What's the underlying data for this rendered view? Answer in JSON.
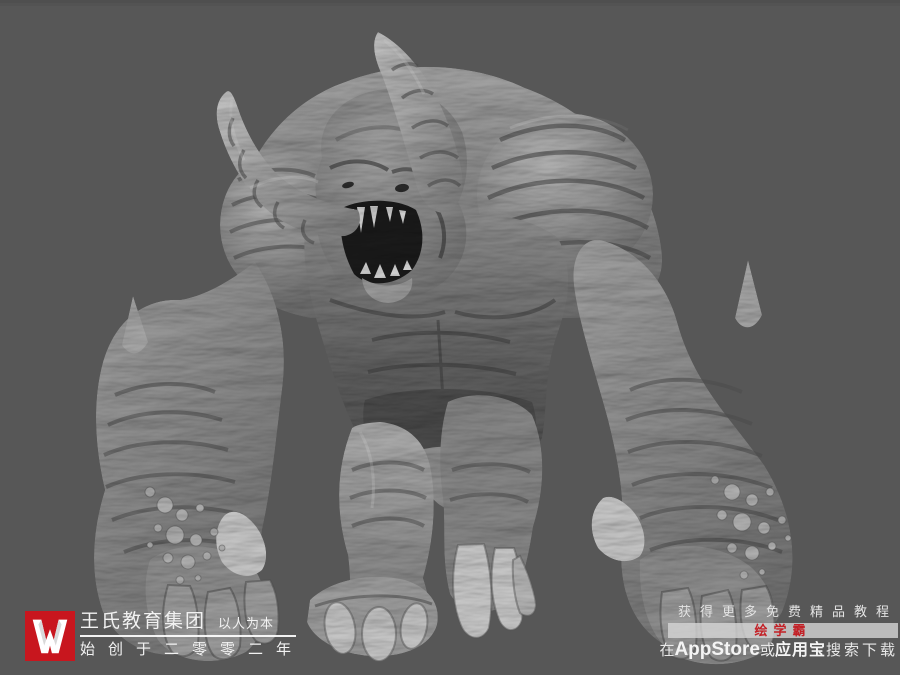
{
  "colors": {
    "background": "#575757",
    "brand_red": "#c8161e",
    "badge_text_red": "#c32026",
    "badge_bar_bg": "rgba(214,214,214,0.8)",
    "watermark_text": "#f2f2f2"
  },
  "artwork": {
    "alt": "Gray clay-render 3D sculpt of a massive horned demon behemoth standing on huge wrinkled forearms, mouth open showing fangs, clawed feet"
  },
  "brand": {
    "logo_glyph": "W",
    "company_name": "王氏教育集团",
    "tagline": "以人为本",
    "since_line": "始创于二零零二年"
  },
  "promo": {
    "line1": "获得更多免费精品教程",
    "badge": "绘学霸",
    "store_prefix": "在",
    "store_appstore": "AppStore",
    "store_or": "或",
    "store_yyb": "应用宝",
    "store_suffix": "搜索下载"
  }
}
